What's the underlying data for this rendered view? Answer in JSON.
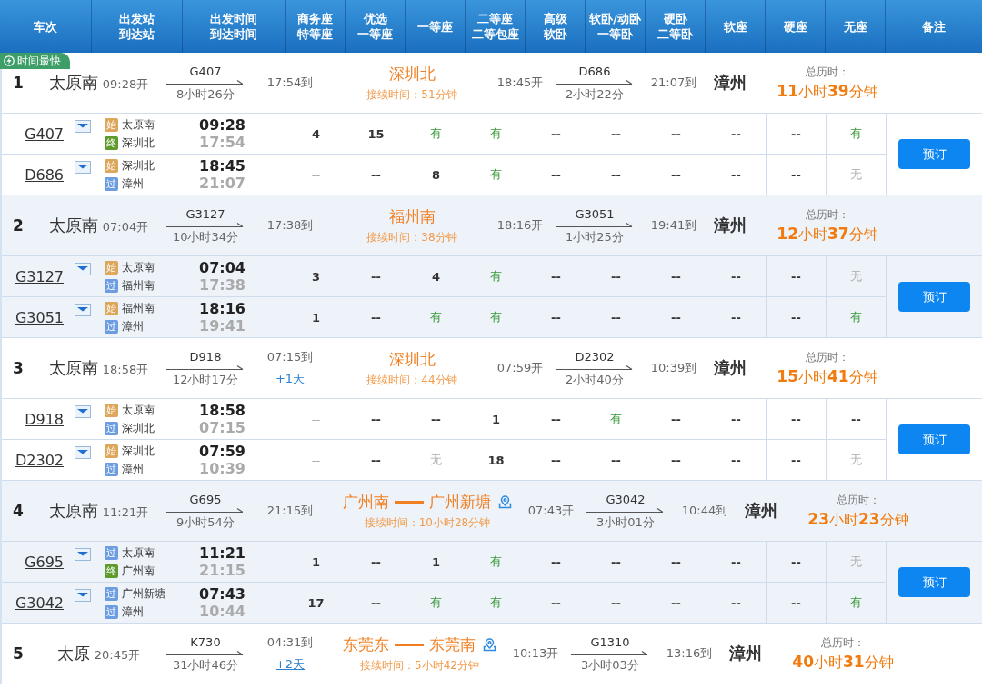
{
  "header": [
    {
      "lines": [
        "车次"
      ]
    },
    {
      "lines": [
        "出发站",
        "到达站"
      ]
    },
    {
      "lines": [
        "出发时间",
        "到达时间"
      ]
    },
    {
      "lines": [
        "商务座",
        "特等座"
      ]
    },
    {
      "lines": [
        "优选",
        "一等座"
      ]
    },
    {
      "lines": [
        "一等座"
      ]
    },
    {
      "lines": [
        "二等座",
        "二等包座"
      ]
    },
    {
      "lines": [
        "高级",
        "软卧"
      ]
    },
    {
      "lines": [
        "软卧/动卧",
        "一等卧"
      ]
    },
    {
      "lines": [
        "硬卧",
        "二等卧"
      ]
    },
    {
      "lines": [
        "软座"
      ]
    },
    {
      "lines": [
        "硬座"
      ]
    },
    {
      "lines": [
        "无座"
      ]
    },
    {
      "lines": [
        "备注"
      ]
    }
  ],
  "routes": [
    {
      "index": "1",
      "tag": "时间最快",
      "origin": "太原南",
      "departs": "09:28开",
      "first": {
        "train": "G407",
        "duration": "8小时26分",
        "arrives": "17:54到"
      },
      "transfer": {
        "stations": [
          "深圳北"
        ],
        "wait": "接续时间：51分钟"
      },
      "second": {
        "departs": "18:45开",
        "train": "D686",
        "duration": "2小时22分",
        "arrives": "21:07到"
      },
      "destination": "漳州",
      "total_label": "总历时：",
      "total": "**11**小时**39**分钟",
      "book_button": "预订",
      "legs": [
        {
          "train": "G407",
          "stops": [
            {
              "badge": "始",
              "kind": "start",
              "name": "太原南"
            },
            {
              "badge": "终",
              "kind": "end",
              "name": "深圳北"
            }
          ],
          "depart": "09:28",
          "arrive": "17:54",
          "seats": [
            {
              "text": "4",
              "kind": "count"
            },
            {
              "text": "15",
              "kind": "count"
            },
            {
              "text": "有",
              "kind": "yes"
            },
            {
              "text": "有",
              "kind": "yes"
            },
            {
              "text": "--",
              "kind": "dash"
            },
            {
              "text": "--",
              "kind": "dash"
            },
            {
              "text": "--",
              "kind": "dash"
            },
            {
              "text": "--",
              "kind": "dash"
            },
            {
              "text": "--",
              "kind": "dash"
            },
            {
              "text": "有",
              "kind": "yes"
            }
          ]
        },
        {
          "train": "D686",
          "stops": [
            {
              "badge": "始",
              "kind": "start",
              "name": "深圳北"
            },
            {
              "badge": "过",
              "kind": "pass",
              "name": "漳州"
            }
          ],
          "depart": "18:45",
          "arrive": "21:07",
          "seats": [
            {
              "text": "--",
              "kind": "na"
            },
            {
              "text": "--",
              "kind": "dash"
            },
            {
              "text": "8",
              "kind": "count"
            },
            {
              "text": "有",
              "kind": "yes"
            },
            {
              "text": "--",
              "kind": "dash"
            },
            {
              "text": "--",
              "kind": "dash"
            },
            {
              "text": "--",
              "kind": "dash"
            },
            {
              "text": "--",
              "kind": "dash"
            },
            {
              "text": "--",
              "kind": "dash"
            },
            {
              "text": "无",
              "kind": "no"
            }
          ]
        }
      ]
    },
    {
      "index": "2",
      "origin": "太原南",
      "departs": "07:04开",
      "first": {
        "train": "G3127",
        "duration": "10小时34分",
        "arrives": "17:38到"
      },
      "transfer": {
        "stations": [
          "福州南"
        ],
        "wait": "接续时间：38分钟"
      },
      "second": {
        "departs": "18:16开",
        "train": "G3051",
        "duration": "1小时25分",
        "arrives": "19:41到"
      },
      "destination": "漳州",
      "total_label": "总历时：",
      "total": "**12**小时**37**分钟",
      "book_button": "预订",
      "legs": [
        {
          "train": "G3127",
          "stops": [
            {
              "badge": "始",
              "kind": "start",
              "name": "太原南"
            },
            {
              "badge": "过",
              "kind": "pass",
              "name": "福州南"
            }
          ],
          "depart": "07:04",
          "arrive": "17:38",
          "seats": [
            {
              "text": "3",
              "kind": "count"
            },
            {
              "text": "--",
              "kind": "dash"
            },
            {
              "text": "4",
              "kind": "count"
            },
            {
              "text": "有",
              "kind": "yes"
            },
            {
              "text": "--",
              "kind": "dash"
            },
            {
              "text": "--",
              "kind": "dash"
            },
            {
              "text": "--",
              "kind": "dash"
            },
            {
              "text": "--",
              "kind": "dash"
            },
            {
              "text": "--",
              "kind": "dash"
            },
            {
              "text": "无",
              "kind": "no"
            }
          ]
        },
        {
          "train": "G3051",
          "stops": [
            {
              "badge": "始",
              "kind": "start",
              "name": "福州南"
            },
            {
              "badge": "过",
              "kind": "pass",
              "name": "漳州"
            }
          ],
          "depart": "18:16",
          "arrive": "19:41",
          "seats": [
            {
              "text": "1",
              "kind": "count"
            },
            {
              "text": "--",
              "kind": "dash"
            },
            {
              "text": "有",
              "kind": "yes"
            },
            {
              "text": "有",
              "kind": "yes"
            },
            {
              "text": "--",
              "kind": "dash"
            },
            {
              "text": "--",
              "kind": "dash"
            },
            {
              "text": "--",
              "kind": "dash"
            },
            {
              "text": "--",
              "kind": "dash"
            },
            {
              "text": "--",
              "kind": "dash"
            },
            {
              "text": "有",
              "kind": "yes"
            }
          ]
        }
      ]
    },
    {
      "index": "3",
      "origin": "太原南",
      "departs": "18:58开",
      "first": {
        "train": "D918",
        "duration": "12小时17分",
        "arrives": "07:15到",
        "day_offset": "+1天"
      },
      "transfer": {
        "stations": [
          "深圳北"
        ],
        "wait": "接续时间：44分钟"
      },
      "second": {
        "departs": "07:59开",
        "train": "D2302",
        "duration": "2小时40分",
        "arrives": "10:39到"
      },
      "destination": "漳州",
      "total_label": "总历时：",
      "total": "**15**小时**41**分钟",
      "book_button": "预订",
      "legs": [
        {
          "train": "D918",
          "stops": [
            {
              "badge": "始",
              "kind": "start",
              "name": "太原南"
            },
            {
              "badge": "过",
              "kind": "pass",
              "name": "深圳北"
            }
          ],
          "depart": "18:58",
          "arrive": "07:15",
          "seats": [
            {
              "text": "--",
              "kind": "na"
            },
            {
              "text": "--",
              "kind": "dash"
            },
            {
              "text": "--",
              "kind": "dash"
            },
            {
              "text": "1",
              "kind": "count"
            },
            {
              "text": "--",
              "kind": "dash"
            },
            {
              "text": "有",
              "kind": "yes"
            },
            {
              "text": "--",
              "kind": "dash"
            },
            {
              "text": "--",
              "kind": "dash"
            },
            {
              "text": "--",
              "kind": "dash"
            },
            {
              "text": "--",
              "kind": "dash"
            }
          ]
        },
        {
          "train": "D2302",
          "stops": [
            {
              "badge": "始",
              "kind": "start",
              "name": "深圳北"
            },
            {
              "badge": "过",
              "kind": "pass",
              "name": "漳州"
            }
          ],
          "depart": "07:59",
          "arrive": "10:39",
          "seats": [
            {
              "text": "--",
              "kind": "na"
            },
            {
              "text": "--",
              "kind": "dash"
            },
            {
              "text": "无",
              "kind": "no"
            },
            {
              "text": "18",
              "kind": "count"
            },
            {
              "text": "--",
              "kind": "dash"
            },
            {
              "text": "--",
              "kind": "dash"
            },
            {
              "text": "--",
              "kind": "dash"
            },
            {
              "text": "--",
              "kind": "dash"
            },
            {
              "text": "--",
              "kind": "dash"
            },
            {
              "text": "无",
              "kind": "no"
            }
          ]
        }
      ]
    },
    {
      "index": "4",
      "origin": "太原南",
      "departs": "11:21开",
      "first": {
        "train": "G695",
        "duration": "9小时54分",
        "arrives": "21:15到"
      },
      "transfer": {
        "stations": [
          "广州南",
          "广州新塘"
        ],
        "wait": "接续时间：10小时28分钟"
      },
      "second": {
        "departs": "07:43开",
        "train": "G3042",
        "duration": "3小时01分",
        "arrives": "10:44到"
      },
      "destination": "漳州",
      "total_label": "总历时：",
      "total": "**23**小时**23**分钟",
      "book_button": "预订",
      "legs": [
        {
          "train": "G695",
          "stops": [
            {
              "badge": "过",
              "kind": "pass",
              "name": "太原南"
            },
            {
              "badge": "终",
              "kind": "end",
              "name": "广州南"
            }
          ],
          "depart": "11:21",
          "arrive": "21:15",
          "seats": [
            {
              "text": "1",
              "kind": "count"
            },
            {
              "text": "--",
              "kind": "dash"
            },
            {
              "text": "1",
              "kind": "count"
            },
            {
              "text": "有",
              "kind": "yes"
            },
            {
              "text": "--",
              "kind": "dash"
            },
            {
              "text": "--",
              "kind": "dash"
            },
            {
              "text": "--",
              "kind": "dash"
            },
            {
              "text": "--",
              "kind": "dash"
            },
            {
              "text": "--",
              "kind": "dash"
            },
            {
              "text": "无",
              "kind": "no"
            }
          ]
        },
        {
          "train": "G3042",
          "stops": [
            {
              "badge": "过",
              "kind": "pass",
              "name": "广州新塘"
            },
            {
              "badge": "过",
              "kind": "pass",
              "name": "漳州"
            }
          ],
          "depart": "07:43",
          "arrive": "10:44",
          "seats": [
            {
              "text": "17",
              "kind": "count"
            },
            {
              "text": "--",
              "kind": "dash"
            },
            {
              "text": "有",
              "kind": "yes"
            },
            {
              "text": "有",
              "kind": "yes"
            },
            {
              "text": "--",
              "kind": "dash"
            },
            {
              "text": "--",
              "kind": "dash"
            },
            {
              "text": "--",
              "kind": "dash"
            },
            {
              "text": "--",
              "kind": "dash"
            },
            {
              "text": "--",
              "kind": "dash"
            },
            {
              "text": "有",
              "kind": "yes"
            }
          ]
        }
      ]
    },
    {
      "index": "5",
      "origin": "太原",
      "departs": "20:45开",
      "first": {
        "train": "K730",
        "duration": "31小时46分",
        "arrives": "04:31到",
        "day_offset": "+2天"
      },
      "transfer": {
        "stations": [
          "东莞东",
          "东莞南"
        ],
        "wait": "接续时间：5小时42分钟"
      },
      "second": {
        "departs": "10:13开",
        "train": "G1310",
        "duration": "3小时03分",
        "arrives": "13:16到"
      },
      "destination": "漳州",
      "total_label": "总历时：",
      "total": "**40**小时**31**分钟"
    }
  ]
}
